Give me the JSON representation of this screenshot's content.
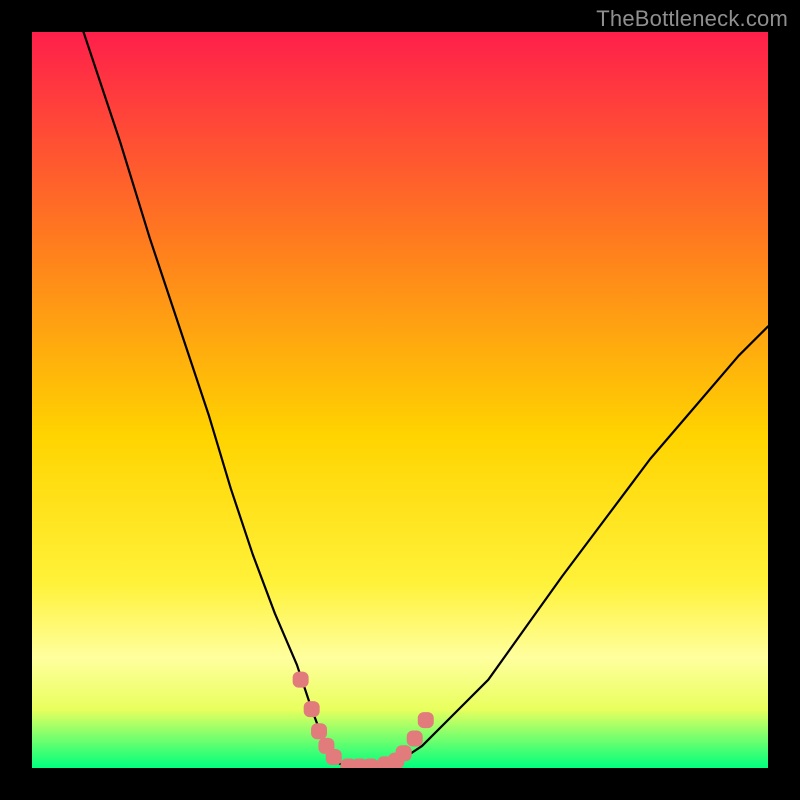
{
  "watermark": "TheBottleneck.com",
  "colors": {
    "frame": "#000000",
    "gradient_top": "#ff1f4b",
    "gradient_upper_mid": "#ff7a1f",
    "gradient_mid": "#ffd400",
    "gradient_lower_mid": "#f6ff66",
    "gradient_yellow_band": "#ffff9e",
    "gradient_base_yellow": "#e9ff5e",
    "gradient_bottom": "#00ff7d",
    "curve": "#000000",
    "marker": "#e27b7b"
  },
  "chart_data": {
    "type": "line",
    "title": "",
    "xlabel": "",
    "ylabel": "",
    "xlim": [
      0,
      100
    ],
    "ylim": [
      0,
      100
    ],
    "series": [
      {
        "name": "bottleneck-curve",
        "x": [
          7,
          12,
          16,
          20,
          24,
          27,
          30,
          33,
          36,
          38,
          39.5,
          41,
          43,
          45,
          48,
          50,
          53,
          57,
          62,
          67,
          72,
          78,
          84,
          90,
          96,
          100
        ],
        "y": [
          100,
          85,
          72,
          60,
          48,
          38,
          29,
          21,
          14,
          8,
          4,
          1,
          0,
          0,
          0,
          1,
          3,
          7,
          12,
          19,
          26,
          34,
          42,
          49,
          56,
          60
        ]
      }
    ],
    "markers": {
      "name": "highlight-points",
      "x": [
        36.5,
        38,
        39,
        40,
        41,
        43,
        44.5,
        46,
        48,
        49.5,
        50.5,
        52,
        53.5
      ],
      "y": [
        12,
        8,
        5,
        3,
        1.5,
        0.2,
        0.2,
        0.2,
        0.5,
        1,
        2,
        4,
        6.5
      ]
    }
  }
}
